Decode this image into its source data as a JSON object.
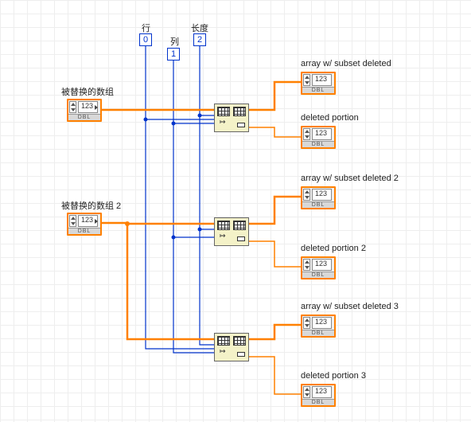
{
  "constants": {
    "row": {
      "label": "行",
      "value": "0"
    },
    "col": {
      "label": "列",
      "value": "1"
    },
    "len": {
      "label": "长度",
      "value": "2"
    }
  },
  "inputs": {
    "array1": {
      "label": "被替换的数组",
      "type": "DBL"
    },
    "array2": {
      "label": "被替换的数组 2",
      "type": "DBL"
    }
  },
  "outputs": {
    "out1a": {
      "label": "array w/ subset deleted",
      "type": "DBL"
    },
    "out1b": {
      "label": "deleted portion",
      "type": "DBL"
    },
    "out2a": {
      "label": "array w/ subset deleted 2",
      "type": "DBL"
    },
    "out2b": {
      "label": "deleted portion 2",
      "type": "DBL"
    },
    "out3a": {
      "label": "array w/ subset deleted 3",
      "type": "DBL"
    },
    "out3b": {
      "label": "deleted portion 3",
      "type": "DBL"
    }
  },
  "functions": {
    "delete1": "Delete From Array",
    "delete2": "Delete From Array",
    "delete3": "Delete From Array"
  }
}
